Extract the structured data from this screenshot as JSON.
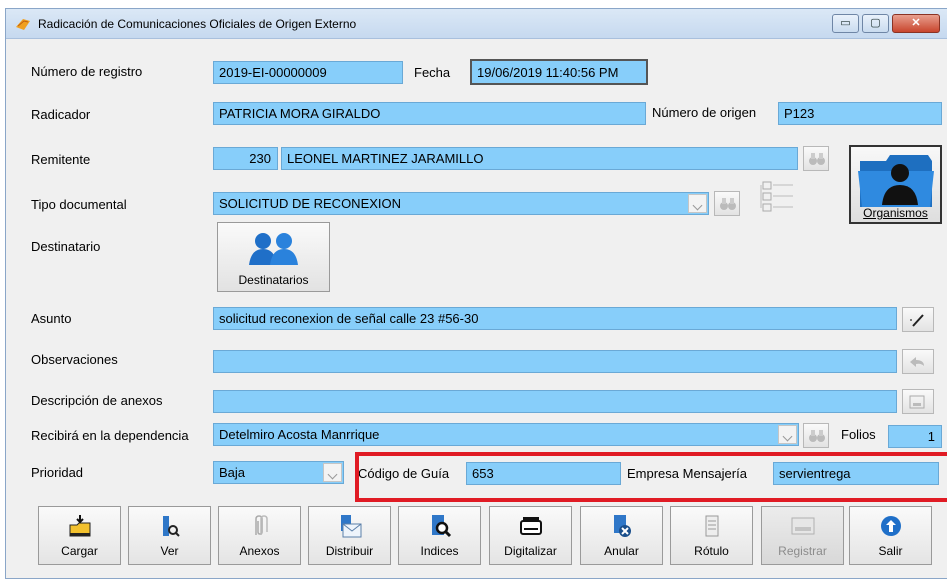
{
  "window": {
    "title": "Radicación de Comunicaciones Oficiales de Origen Externo",
    "controls": {
      "minimize": "▭",
      "maximize": "▢",
      "close": "✕"
    }
  },
  "form": {
    "numero_registro": {
      "label": "Número de registro",
      "value": "2019-EI-00000009"
    },
    "fecha": {
      "label": "Fecha",
      "value": "19/06/2019 11:40:56 PM"
    },
    "radicador": {
      "label": "Radicador",
      "value": "PATRICIA MORA GIRALDO"
    },
    "numero_origen": {
      "label": "Número de origen",
      "value": "P123"
    },
    "remitente": {
      "label": "Remitente",
      "code": "230",
      "name": "LEONEL MARTINEZ JARAMILLO"
    },
    "tipo_documental": {
      "label": "Tipo documental",
      "value": "SOLICITUD DE RECONEXION"
    },
    "destinatario": {
      "label": "Destinatario",
      "button": "Destinatarios"
    },
    "asunto": {
      "label": "Asunto",
      "value": "solicitud reconexion de señal calle 23 #56-30"
    },
    "observaciones": {
      "label": "Observaciones",
      "value": ""
    },
    "descripcion_anexos": {
      "label": "Descripción de anexos",
      "value": ""
    },
    "dependencia": {
      "label": "Recibirá en la dependencia",
      "value": "Detelmiro Acosta Manrrique"
    },
    "folios": {
      "label": "Folios",
      "value": "1"
    },
    "prioridad": {
      "label": "Prioridad",
      "value": "Baja"
    },
    "codigo_guia": {
      "label": "Código de Guía",
      "value": "653"
    },
    "empresa_mensajeria": {
      "label": "Empresa Mensajería",
      "value": "servientrega"
    }
  },
  "organismos_button": "Organismos",
  "toolbar": [
    {
      "label": "Cargar",
      "icon": "upload-folder-icon"
    },
    {
      "label": "Ver",
      "icon": "view-document-icon"
    },
    {
      "label": "Anexos",
      "icon": "paperclip-icon"
    },
    {
      "label": "Distribuir",
      "icon": "envelope-icon"
    },
    {
      "label": "Indices",
      "icon": "search-document-icon"
    },
    {
      "label": "Digitalizar",
      "icon": "scanner-icon"
    },
    {
      "label": "Anular",
      "icon": "cancel-document-icon"
    },
    {
      "label": "Rótulo",
      "icon": "label-icon"
    },
    {
      "label": "Registrar",
      "icon": "register-icon",
      "disabled": true
    },
    {
      "label": "Salir",
      "icon": "exit-icon"
    }
  ],
  "colors": {
    "field_bg": "#87cefa",
    "highlight": "#e01b24",
    "window_bg": "#f0f0f0"
  }
}
